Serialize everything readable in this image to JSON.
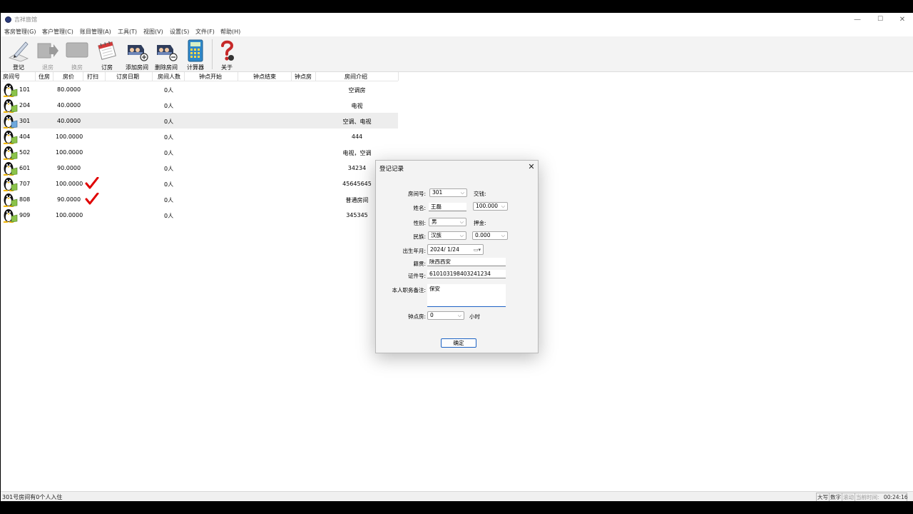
{
  "window": {
    "title": "吉祥旅馆",
    "min_glyph": "—",
    "max_glyph": "☐",
    "close_glyph": "✕"
  },
  "menu": [
    "客房管理(G)",
    "客户管理(C)",
    "账目管理(A)",
    "工具(T)",
    "视图(V)",
    "设置(S)",
    "文件(F)",
    "帮助(H)"
  ],
  "toolbar": [
    {
      "label": "登记",
      "icon": "register-pen-icon",
      "enabled": true
    },
    {
      "label": "退房",
      "icon": "checkout-arrow-icon",
      "enabled": false
    },
    {
      "label": "换房",
      "icon": "change-room-icon",
      "enabled": false
    },
    {
      "label": "订房",
      "icon": "calendar-icon",
      "enabled": true
    },
    {
      "label": "添加房间",
      "icon": "add-room-icon",
      "enabled": true
    },
    {
      "label": "删除房间",
      "icon": "delete-room-icon",
      "enabled": true
    },
    {
      "label": "计算器",
      "icon": "calculator-icon",
      "enabled": true
    },
    {
      "label": "关于",
      "icon": "help-question-icon",
      "enabled": true
    }
  ],
  "table": {
    "columns": [
      "房间号",
      "住房",
      "房价",
      "打扫",
      "订房日期",
      "房间人数",
      "钟点开始",
      "钟点结束",
      "钟点房",
      "房间介绍"
    ],
    "rows": [
      {
        "room": "101",
        "price": "80.0000",
        "clean": false,
        "people": "0人",
        "intro": "空调房"
      },
      {
        "room": "204",
        "price": "40.0000",
        "clean": false,
        "people": "0人",
        "intro": "电视"
      },
      {
        "room": "301",
        "price": "40.0000",
        "clean": false,
        "people": "0人",
        "intro": "空调、电视"
      },
      {
        "room": "404",
        "price": "100.0000",
        "clean": false,
        "people": "0人",
        "intro": "444"
      },
      {
        "room": "502",
        "price": "100.0000",
        "clean": false,
        "people": "0人",
        "intro": "电视，空调"
      },
      {
        "room": "601",
        "price": "90.0000",
        "clean": false,
        "people": "0人",
        "intro": "34234"
      },
      {
        "room": "707",
        "price": "100.0000",
        "clean": true,
        "people": "0人",
        "intro": "45645645"
      },
      {
        "room": "808",
        "price": "90.0000",
        "clean": true,
        "people": "0人",
        "intro": "普通房间"
      },
      {
        "room": "909",
        "price": "100.0000",
        "clean": false,
        "people": "0人",
        "intro": "345345"
      }
    ],
    "selected_room": "301"
  },
  "status": {
    "message": "301号房间有0个人入住",
    "caps": "大写",
    "num": "数字",
    "scroll": "滚动",
    "time_label": "当前时间:",
    "time": "00:24:16"
  },
  "dialog": {
    "title": "登记记录",
    "close_glyph": "✕",
    "room_label": "房间号:",
    "room_value": "301",
    "money_label": "交钱:",
    "name_label": "姓名:",
    "name_value": "王磊",
    "money_value": "100.000",
    "gender_label": "性别:",
    "gender_value": "男",
    "deposit_label": "押金:",
    "ethnic_label": "民族:",
    "ethnic_value": "汉族",
    "deposit_value": "0.000",
    "birth_label": "出生年月:",
    "birth_value": "2024/  1/24",
    "origin_label": "籍贯:",
    "origin_value": "陕西西安",
    "id_label": "证件号:",
    "id_value": "610103198403241234",
    "job_label": "本人职务备注:",
    "job_value": "保安",
    "hourly_label": "钟点房:",
    "hourly_value": "0",
    "hour_unit": "小时",
    "ok_label": "确定"
  }
}
